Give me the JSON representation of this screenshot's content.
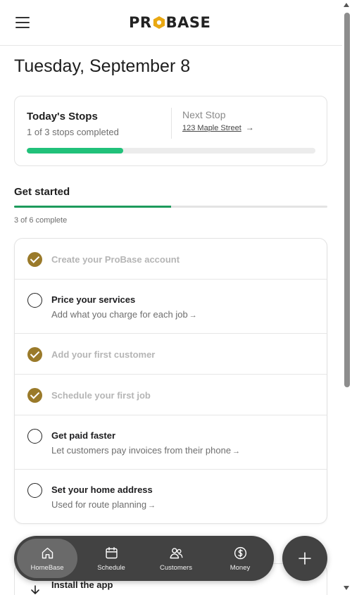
{
  "header": {
    "logo_text": "PROBASE",
    "logo_left": "PR",
    "logo_right": "BASE",
    "menu_icon": "hamburger-menu-icon"
  },
  "date_title": "Tuesday, September 8",
  "stops": {
    "title": "Today's Stops",
    "completed_text": "1 of 3 stops completed",
    "progress_fraction": 0.333,
    "next_label": "Next Stop",
    "next_address": "123 Maple Street",
    "next_arrow": "→",
    "accent_color": "#21c17a"
  },
  "get_started": {
    "title": "Get started",
    "count_text": "3 of 6 complete",
    "progress_fraction": 0.5,
    "accent_color": "#1d9b5c",
    "check_color": "#9a7a2a",
    "tasks": [
      {
        "title": "Create your ProBase account",
        "subtitle": "",
        "done": true
      },
      {
        "title": "Price your services",
        "subtitle": "Add what you charge for each job",
        "arrow": "→",
        "done": false
      },
      {
        "title": "Add your first customer",
        "subtitle": "",
        "done": true
      },
      {
        "title": "Schedule your first job",
        "subtitle": "",
        "done": true
      },
      {
        "title": "Get paid faster",
        "subtitle": "Let customers pay invoices from their phone",
        "arrow": "→",
        "done": false
      },
      {
        "title": "Set your home address",
        "subtitle": "Used for route planning",
        "arrow": "→",
        "done": false
      }
    ]
  },
  "install": {
    "label": "Install the app",
    "icon": "download-icon"
  },
  "bottom_nav": {
    "items": [
      {
        "label": "HomeBase",
        "icon": "home-icon",
        "active": true
      },
      {
        "label": "Schedule",
        "icon": "calendar-icon",
        "active": false
      },
      {
        "label": "Customers",
        "icon": "users-icon",
        "active": false
      },
      {
        "label": "Money",
        "icon": "dollar-icon",
        "active": false
      }
    ],
    "fab_icon": "plus-icon"
  }
}
